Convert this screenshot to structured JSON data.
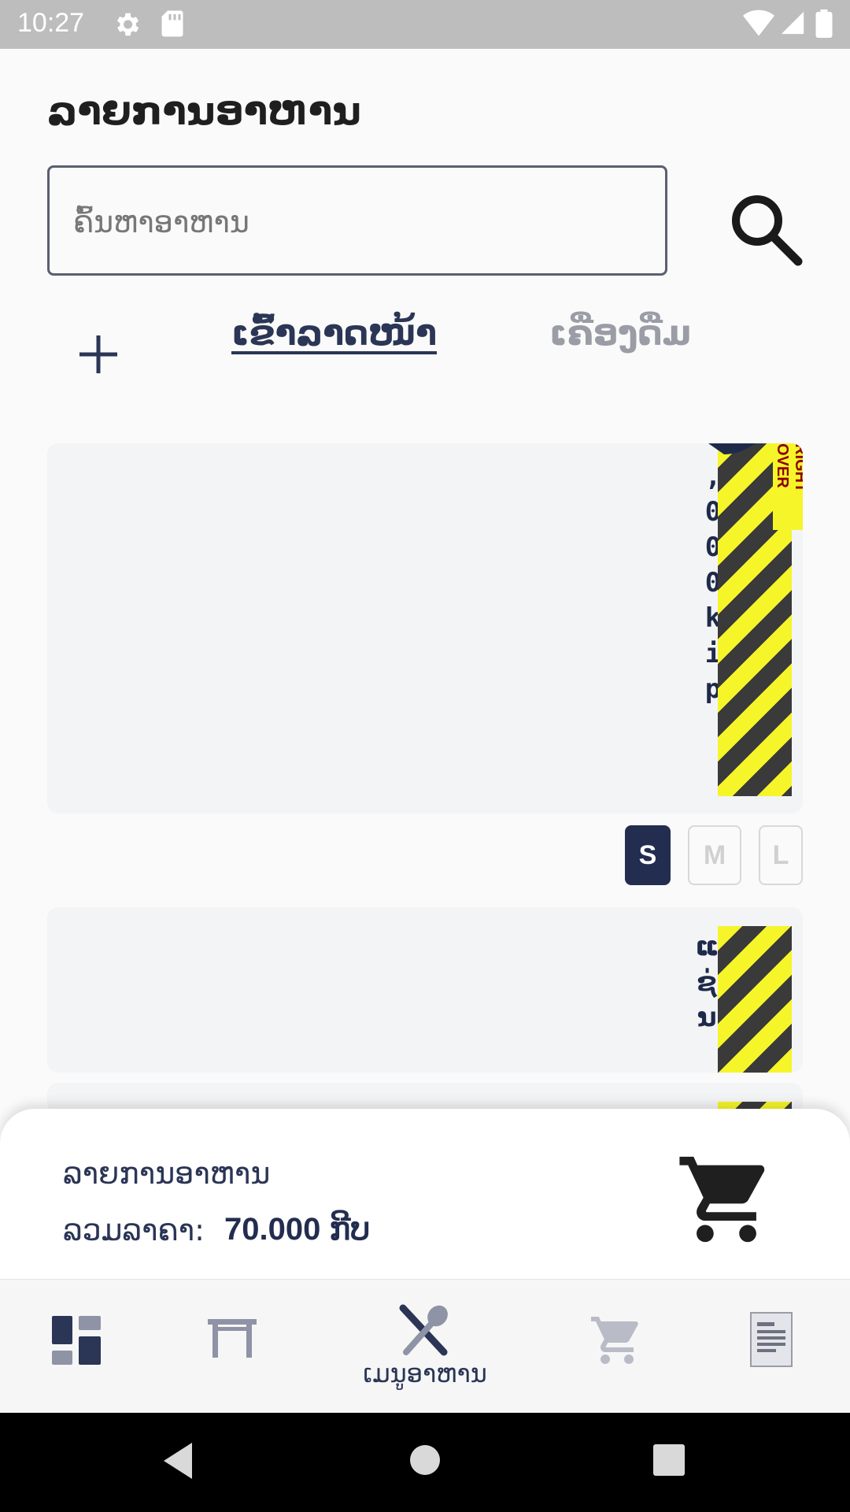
{
  "status_bar": {
    "time": "10:27"
  },
  "header": {
    "title": "ລາຍການອາຫານ"
  },
  "search": {
    "placeholder": "ຄົ້ນຫາອາຫານ"
  },
  "tabs": [
    {
      "label": "ເຂົ້າລາດໜ້າ",
      "active": true
    },
    {
      "label": "ເຄື່ອງດື່ມ",
      "active": false
    }
  ],
  "cards": [
    {
      "price_text": ",000kip",
      "stripe_label": "RIGHT OVER"
    },
    {
      "name_text": "ແຊ່ນ"
    }
  ],
  "sizes": [
    {
      "label": "S",
      "selected": true
    },
    {
      "label": "M",
      "selected": false
    },
    {
      "label": "L",
      "selected": false
    }
  ],
  "summary": {
    "title": "ລາຍການອາຫານ",
    "total_label": "ລວມລາຄາ:",
    "total_value": "70.000 ກີບ"
  },
  "bottom_nav": {
    "items": [
      {
        "icon": "dashboard-icon",
        "active": false
      },
      {
        "icon": "table-icon",
        "active": false
      },
      {
        "icon": "utensils-icon",
        "active": true,
        "label": "ເມນູອາຫານ"
      },
      {
        "icon": "cart-icon",
        "active": false
      },
      {
        "icon": "receipt-icon",
        "active": false
      }
    ]
  },
  "colors": {
    "primary": "#232d4f",
    "inactive": "#9a9ca6",
    "background": "#fafafa",
    "card": "#f3f4f6"
  }
}
